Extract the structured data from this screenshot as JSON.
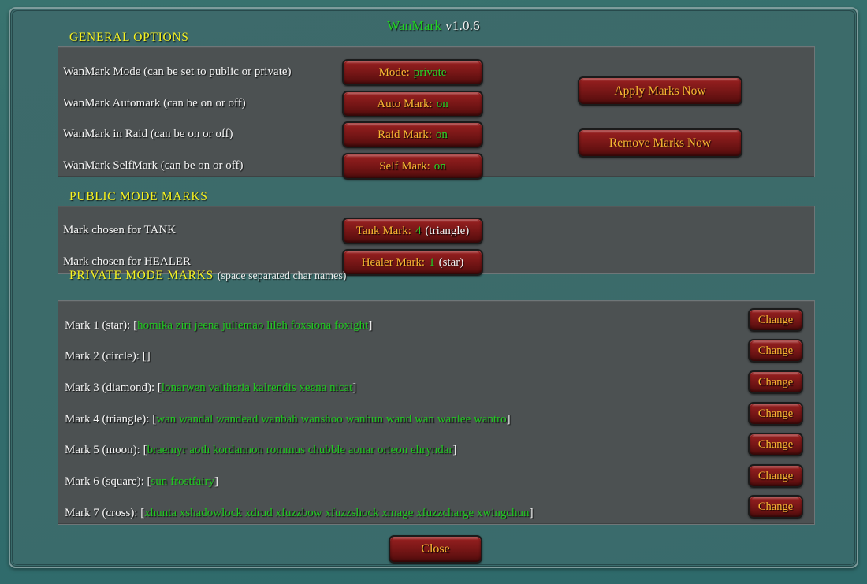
{
  "window": {
    "app_name": "WanMark",
    "version": "v1.0.6"
  },
  "general_options": {
    "heading": "GENERAL OPTIONS",
    "rows": [
      {
        "label": "WanMark Mode (can be set to public or private)",
        "button_prefix": "Mode:",
        "button_value": "private"
      },
      {
        "label": "WanMark Automark (can be on or off)",
        "button_prefix": "Auto Mark:",
        "button_value": "on"
      },
      {
        "label": "WanMark in Raid (can be on or off)",
        "button_prefix": "Raid Mark:",
        "button_value": "on"
      },
      {
        "label": "WanMark SelfMark (can be on or off)",
        "button_prefix": "Self Mark:",
        "button_value": "on"
      }
    ],
    "apply_button": "Apply Marks Now",
    "remove_button": "Remove Marks Now"
  },
  "public_mode_marks": {
    "heading": "PUBLIC MODE MARKS",
    "rows": [
      {
        "label": "Mark chosen for TANK",
        "button_prefix": "Tank Mark:",
        "button_value": "4",
        "button_suffix": "(triangle)"
      },
      {
        "label": "Mark chosen for HEALER",
        "button_prefix": "Healer Mark:",
        "button_value": "1",
        "button_suffix": "(star)"
      }
    ]
  },
  "private_mode_marks": {
    "heading": "PRIVATE MODE MARKS",
    "heading_note": "(space separated char names)",
    "change_label": "Change",
    "rows": [
      {
        "label": "Mark 1 (star):",
        "names": "homika ziri jeena juliemao lileh foxsiona foxight"
      },
      {
        "label": "Mark 2 (circle):",
        "names": ""
      },
      {
        "label": "Mark 3 (diamond):",
        "names": "lonarwen valtheria kalrendis xeena nicat"
      },
      {
        "label": "Mark 4 (triangle):",
        "names": "wan wandal wandead wanbah wanshoo wanhun wand wan wanlee wantro"
      },
      {
        "label": "Mark 5 (moon):",
        "names": "braemyr aoth kordannon rommus chubble aonar orieon ehryndar"
      },
      {
        "label": "Mark 6 (square):",
        "names": "sun frostfairy"
      },
      {
        "label": "Mark 7 (cross):",
        "names": "xhunta xshadowlock xdrud xfuzzbow xfuzzshock xmage xfuzzcharge xwingchun"
      }
    ]
  },
  "footer": {
    "close_label": "Close"
  },
  "colors": {
    "frame_teal": "#3c6b6a",
    "panel_gray": "#4c5152",
    "heading_yellow": "#f6f223",
    "button_gold": "#f8b733",
    "value_green": "#28d428",
    "title_green": "#21d321",
    "names_green": "#21c721"
  }
}
